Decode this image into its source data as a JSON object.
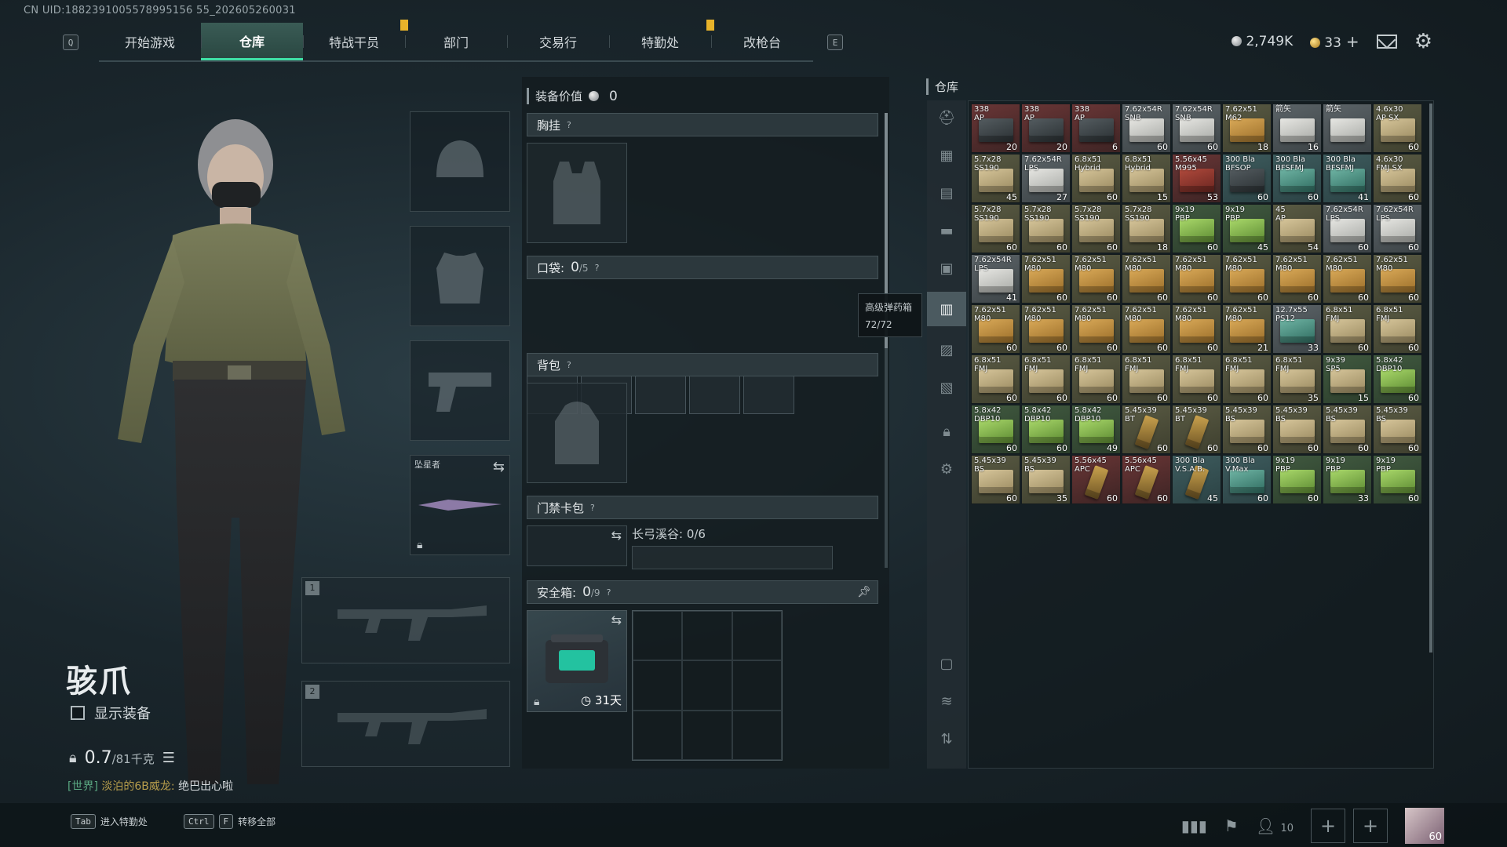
{
  "uid": "CN UID:1882391005578995156 55_202605260031",
  "nav": {
    "left_key": "Q",
    "right_key": "E",
    "tabs": [
      "开始游戏",
      "仓库",
      "特战干员",
      "部门",
      "交易行",
      "特勤处",
      "改枪台"
    ],
    "active_tab": 1,
    "flagged_tabs": [
      2,
      5
    ]
  },
  "currency": {
    "silver": "2,749K",
    "gold": "33"
  },
  "operator": {
    "name": "骇爪",
    "show_gear_label": "显示装备",
    "weight": "0.7",
    "weight_max": "/81千克"
  },
  "chat": {
    "channel": "[世界]",
    "nick": "淡泊的6B威龙:",
    "message": "绝巴出心啦"
  },
  "equipment": {
    "melee_label": "坠星者",
    "weapon_slot_1": "1",
    "weapon_slot_2": "2"
  },
  "loadout": {
    "value_label": "装备价值",
    "value": "0",
    "chest_rig": "胸挂",
    "pockets_label": "口袋:",
    "pockets_count": "0",
    "pockets_max": "/5",
    "backpack": "背包",
    "keycard": "门禁卡包",
    "keycard_area": "长弓溪谷: 0/6",
    "safe_label": "安全箱:",
    "safe_count": "0",
    "safe_max": "/9",
    "safe_days": "31天"
  },
  "tooltip": {
    "title": "高级弹药箱",
    "value": "72/72"
  },
  "warehouse": {
    "title": "仓库",
    "items": [
      {
        "name": "338\nAP",
        "count": "20",
        "tier": "red",
        "color": "dark"
      },
      {
        "name": "338\nAP",
        "count": "20",
        "tier": "red",
        "color": "dark"
      },
      {
        "name": "338\nAP",
        "count": "6",
        "tier": "red",
        "color": "dark"
      },
      {
        "name": "7.62x54R\nSNB",
        "count": "60",
        "tier": "grey",
        "color": "white"
      },
      {
        "name": "7.62x54R\nSNB",
        "count": "60",
        "tier": "grey",
        "color": "white"
      },
      {
        "name": "7.62x51\nM62",
        "count": "18",
        "tier": "olive",
        "color": "gold"
      },
      {
        "name": "箭矢",
        "count": "16",
        "tier": "grey",
        "color": "white"
      },
      {
        "name": "箭矢",
        "count": "",
        "tier": "grey",
        "color": "white"
      },
      {
        "name": "4.6x30\nAP SX",
        "count": "60",
        "tier": "olive",
        "color": "tan"
      },
      {
        "name": "5.7x28\nSS190",
        "count": "45",
        "tier": "olive",
        "color": "tan"
      },
      {
        "name": "7.62x54R\nLPS",
        "count": "27",
        "tier": "grey",
        "color": "white"
      },
      {
        "name": "6.8x51\nHybrid",
        "count": "60",
        "tier": "olive",
        "color": "tan"
      },
      {
        "name": "6.8x51\nHybrid",
        "count": "15",
        "tier": "olive",
        "color": "tan"
      },
      {
        "name": "5.56x45\nM995",
        "count": "53",
        "tier": "red",
        "color": "red"
      },
      {
        "name": "300 Bla\nBFSOP",
        "count": "60",
        "tier": "teal",
        "color": "dark"
      },
      {
        "name": "300 Bla\nBFSFMJ",
        "count": "60",
        "tier": "teal",
        "color": "teal"
      },
      {
        "name": "300 Bla\nBFSFMJ",
        "count": "41",
        "tier": "teal",
        "color": "teal"
      },
      {
        "name": "4.6x30\nFMJ SX",
        "count": "60",
        "tier": "olive",
        "color": "tan"
      },
      {
        "name": "5.7x28\nSS190",
        "count": "60",
        "tier": "olive",
        "color": "tan"
      },
      {
        "name": "5.7x28\nSS190",
        "count": "60",
        "tier": "olive",
        "color": "tan"
      },
      {
        "name": "5.7x28\nSS190",
        "count": "60",
        "tier": "olive",
        "color": "tan"
      },
      {
        "name": "5.7x28\nSS190",
        "count": "18",
        "tier": "olive",
        "color": "tan"
      },
      {
        "name": "9x19\nPBP",
        "count": "60",
        "tier": "green",
        "color": "green"
      },
      {
        "name": "9x19\nPBP",
        "count": "45",
        "tier": "green",
        "color": "green"
      },
      {
        "name": "45\nAP",
        "count": "54",
        "tier": "olive",
        "color": "tan"
      },
      {
        "name": "7.62x54R\nLPS",
        "count": "60",
        "tier": "grey",
        "color": "white"
      },
      {
        "name": "7.62x54R\nLPS",
        "count": "60",
        "tier": "grey",
        "color": "white"
      },
      {
        "name": "7.62x54R\nLPS",
        "count": "41",
        "tier": "grey",
        "color": "white"
      },
      {
        "name": "7.62x51\nM80",
        "count": "60",
        "tier": "olive",
        "color": "gold"
      },
      {
        "name": "7.62x51\nM80",
        "count": "60",
        "tier": "olive",
        "color": "gold"
      },
      {
        "name": "7.62x51\nM80",
        "count": "60",
        "tier": "olive",
        "color": "gold"
      },
      {
        "name": "7.62x51\nM80",
        "count": "60",
        "tier": "olive",
        "color": "gold"
      },
      {
        "name": "7.62x51\nM80",
        "count": "60",
        "tier": "olive",
        "color": "gold"
      },
      {
        "name": "7.62x51\nM80",
        "count": "60",
        "tier": "olive",
        "color": "gold"
      },
      {
        "name": "7.62x51\nM80",
        "count": "60",
        "tier": "olive",
        "color": "gold"
      },
      {
        "name": "7.62x51\nM80",
        "count": "60",
        "tier": "olive",
        "color": "gold"
      },
      {
        "name": "7.62x51\nM80",
        "count": "60",
        "tier": "olive",
        "color": "gold"
      },
      {
        "name": "7.62x51\nM80",
        "count": "60",
        "tier": "olive",
        "color": "gold"
      },
      {
        "name": "7.62x51\nM80",
        "count": "60",
        "tier": "olive",
        "color": "gold"
      },
      {
        "name": "7.62x51\nM80",
        "count": "60",
        "tier": "olive",
        "color": "gold"
      },
      {
        "name": "7.62x51\nM80",
        "count": "60",
        "tier": "olive",
        "color": "gold"
      },
      {
        "name": "7.62x51\nM80",
        "count": "21",
        "tier": "olive",
        "color": "gold"
      },
      {
        "name": "12.7x55\nPS12",
        "count": "33",
        "tier": "grey",
        "color": "teal"
      },
      {
        "name": "6.8x51\nFMJ",
        "count": "60",
        "tier": "olive",
        "color": "tan"
      },
      {
        "name": "6.8x51\nFMJ",
        "count": "60",
        "tier": "olive",
        "color": "tan"
      },
      {
        "name": "6.8x51\nFMJ",
        "count": "60",
        "tier": "olive",
        "color": "tan"
      },
      {
        "name": "6.8x51\nFMJ",
        "count": "60",
        "tier": "olive",
        "color": "tan"
      },
      {
        "name": "6.8x51\nFMJ",
        "count": "60",
        "tier": "olive",
        "color": "tan"
      },
      {
        "name": "6.8x51\nFMJ",
        "count": "60",
        "tier": "olive",
        "color": "tan"
      },
      {
        "name": "6.8x51\nFMJ",
        "count": "60",
        "tier": "olive",
        "color": "tan"
      },
      {
        "name": "6.8x51\nFMJ",
        "count": "60",
        "tier": "olive",
        "color": "tan"
      },
      {
        "name": "6.8x51\nFMJ",
        "count": "35",
        "tier": "olive",
        "color": "tan"
      },
      {
        "name": "9x39\nSP5",
        "count": "15",
        "tier": "green",
        "color": "tan"
      },
      {
        "name": "5.8x42\nDBP10",
        "count": "60",
        "tier": "green",
        "color": "green"
      },
      {
        "name": "5.8x42\nDBP10",
        "count": "60",
        "tier": "green",
        "color": "green"
      },
      {
        "name": "5.8x42\nDBP10",
        "count": "60",
        "tier": "green",
        "color": "green"
      },
      {
        "name": "5.8x42\nDBP10",
        "count": "49",
        "tier": "green",
        "color": "green"
      },
      {
        "name": "5.45x39\nBT",
        "count": "60",
        "tier": "olive",
        "color": "brass"
      },
      {
        "name": "5.45x39\nBT",
        "count": "60",
        "tier": "olive",
        "color": "brass"
      },
      {
        "name": "5.45x39\nBS",
        "count": "60",
        "tier": "olive",
        "color": "tan"
      },
      {
        "name": "5.45x39\nBS",
        "count": "60",
        "tier": "olive",
        "color": "tan"
      },
      {
        "name": "5.45x39\nBS",
        "count": "60",
        "tier": "olive",
        "color": "tan"
      },
      {
        "name": "5.45x39\nBS",
        "count": "60",
        "tier": "olive",
        "color": "tan"
      },
      {
        "name": "5.45x39\nBS",
        "count": "60",
        "tier": "olive",
        "color": "tan"
      },
      {
        "name": "5.45x39\nBS",
        "count": "35",
        "tier": "olive",
        "color": "tan"
      },
      {
        "name": "5.56x45\nAPC",
        "count": "60",
        "tier": "red",
        "color": "brass"
      },
      {
        "name": "5.56x45\nAPC",
        "count": "60",
        "tier": "red",
        "color": "brass"
      },
      {
        "name": "300 Bla\nV.S.A.B.",
        "count": "45",
        "tier": "teal",
        "color": "brass"
      },
      {
        "name": "300 Bla\nV.Max",
        "count": "60",
        "tier": "teal",
        "color": "teal"
      },
      {
        "name": "9x19\nPBP",
        "count": "60",
        "tier": "green",
        "color": "green"
      },
      {
        "name": "9x19\nPBP",
        "count": "33",
        "tier": "green",
        "color": "green"
      },
      {
        "name": "9x19\nPBP",
        "count": "60",
        "tier": "green",
        "color": "green"
      }
    ]
  },
  "hints": [
    {
      "keys": [
        "Tab"
      ],
      "label": "进入特勤处"
    },
    {
      "keys": [
        "Ctrl",
        "F"
      ],
      "label": "转移全部"
    }
  ],
  "friends_count": "10",
  "avatar_level": "60",
  "colors": {
    "accent": "#3fe0a6",
    "flag": "#e8b32a"
  }
}
